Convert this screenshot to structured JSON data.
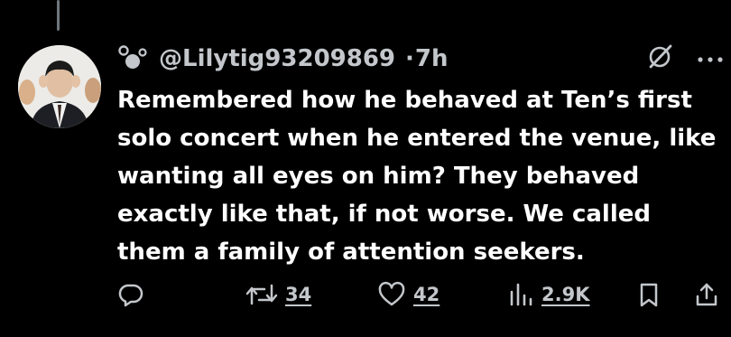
{
  "tweet": {
    "handle": "@Lilytig93209869",
    "separator": "·",
    "time": "7h",
    "text": "Remembered how he behaved at Ten’s first solo concert when he entered the venue, like wanting all eyes on him? They behaved exactly like that, if not worse. We called them a family of attention seekers."
  },
  "actions": {
    "retweets": "34",
    "likes": "42",
    "views": "2.9K"
  },
  "icons": {
    "reply": "reply-icon",
    "retweet": "retweet-icon",
    "like": "heart-icon",
    "views": "views-icon",
    "bookmark": "bookmark-icon",
    "share": "share-icon",
    "grok": "slash-circle-icon",
    "more": "more-icon",
    "badge": "bubbles-icon"
  },
  "colors": {
    "background": "#000000",
    "text": "#ffffff",
    "secondary": "#c3c7cb",
    "thread_line": "#6e767d"
  }
}
